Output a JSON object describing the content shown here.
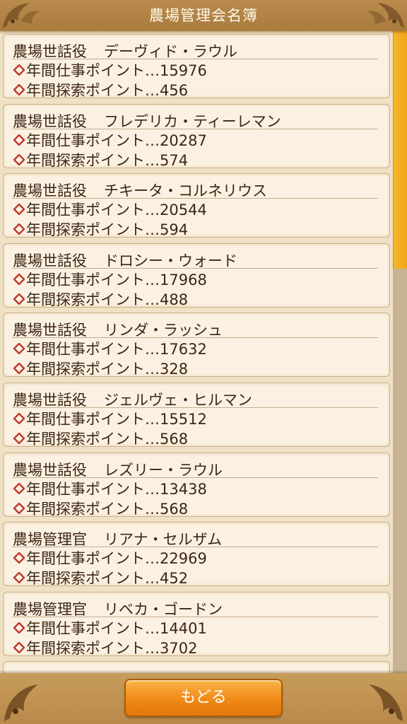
{
  "header": {
    "title": "農場管理会名簿"
  },
  "members": [
    {
      "role": "農場世話役",
      "name": "デーヴィド・ラウル",
      "work_label": "年間仕事ポイント…15976",
      "explore_label": "年間探索ポイント…456"
    },
    {
      "role": "農場世話役",
      "name": "フレデリカ・ティーレマン",
      "work_label": "年間仕事ポイント…20287",
      "explore_label": "年間探索ポイント…574"
    },
    {
      "role": "農場世話役",
      "name": "チキータ・コルネリウス",
      "work_label": "年間仕事ポイント…20544",
      "explore_label": "年間探索ポイント…594"
    },
    {
      "role": "農場世話役",
      "name": "ドロシー・ウォード",
      "work_label": "年間仕事ポイント…17968",
      "explore_label": "年間探索ポイント…488"
    },
    {
      "role": "農場世話役",
      "name": "リンダ・ラッシュ",
      "work_label": "年間仕事ポイント…17632",
      "explore_label": "年間探索ポイント…328"
    },
    {
      "role": "農場世話役",
      "name": "ジェルヴェ・ヒルマン",
      "work_label": "年間仕事ポイント…15512",
      "explore_label": "年間探索ポイント…568"
    },
    {
      "role": "農場世話役",
      "name": "レズリー・ラウル",
      "work_label": "年間仕事ポイント…13438",
      "explore_label": "年間探索ポイント…568"
    },
    {
      "role": "農場管理官",
      "name": "リアナ・セルザム",
      "work_label": "年間仕事ポイント…22969",
      "explore_label": "年間探索ポイント…452"
    },
    {
      "role": "農場管理官",
      "name": "リベカ・ゴードン",
      "work_label": "年間仕事ポイント…14401",
      "explore_label": "年間探索ポイント…3702"
    }
  ],
  "scroll": {
    "position_fraction": 0.0,
    "visible_fraction": 0.37
  },
  "footer": {
    "back_label": "もどる"
  },
  "colors": {
    "accent_orange": "#f08a16",
    "scroll_thumb": "#f5b629",
    "diamond": "#c0392b",
    "header_brown": "#a97b3d"
  },
  "icons": {
    "bullet": "diamond-icon",
    "corner": "ornament-icon"
  }
}
